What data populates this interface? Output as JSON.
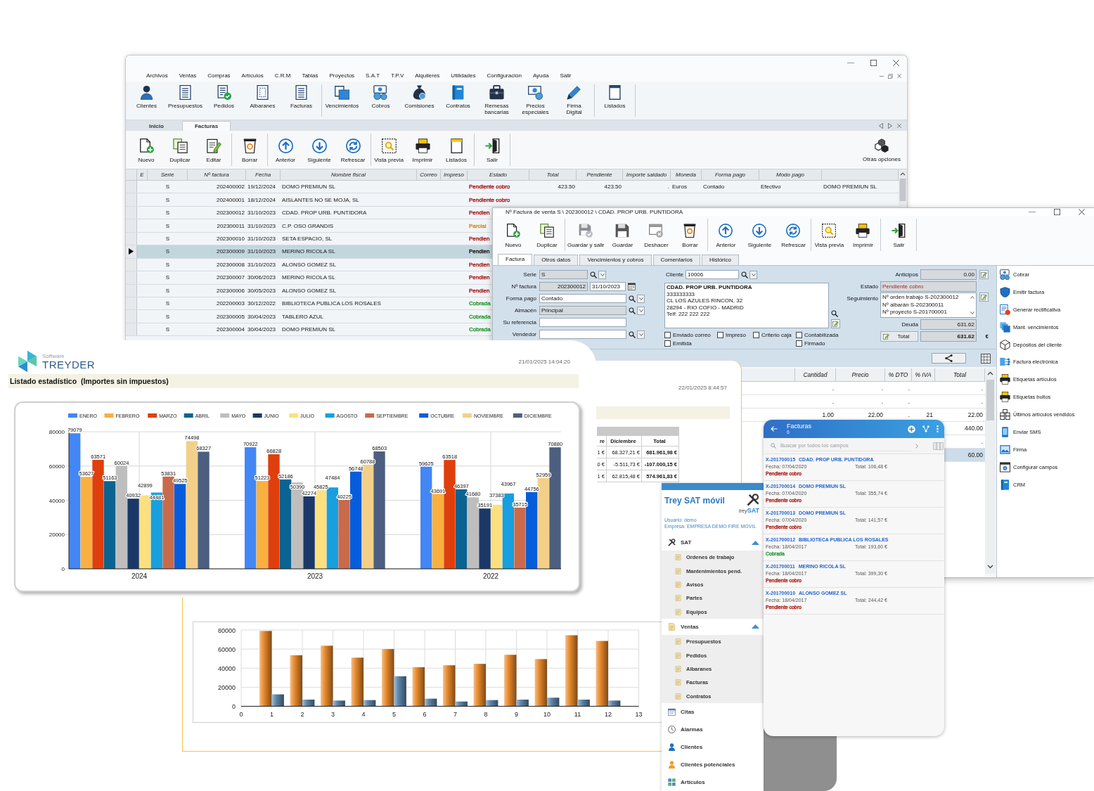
{
  "main_window": {
    "menu": [
      "Archivos",
      "Ventas",
      "Compras",
      "Artículos",
      "C.R.M",
      "Tablas",
      "Proyectos",
      "S.A.T",
      "T.P.V",
      "Alquileres",
      "Utilidades",
      "Configuración",
      "Ayuda",
      "Salir"
    ],
    "ribbon": [
      [
        "Clientes",
        "Presupuestos",
        "Pedidos",
        "Albaranes",
        "Facturas"
      ],
      [
        "Vencimientos",
        "Cobros",
        "Comisiones",
        "Contratos",
        "Remesas bancarias",
        "Precios especiales",
        "Firma Digital"
      ],
      [
        "Listados"
      ]
    ],
    "doc_tabs": [
      {
        "label": "Inicio",
        "selected": false
      },
      {
        "label": "Facturas",
        "selected": true
      }
    ],
    "toolbar": [
      [
        "Nuevo",
        "Duplicar",
        "Editar"
      ],
      [
        "Borrar"
      ],
      [
        "Anterior",
        "Siguiente",
        "Refrescar"
      ],
      [
        "Vista previa",
        "Imprimir",
        "Listados"
      ],
      [
        "Salir"
      ]
    ],
    "more_options": "Otras opciones",
    "table": {
      "columns": [
        "E",
        "Serie",
        "Nº factura",
        "Fecha",
        "Nombre fiscal",
        "Correo",
        "Impreso",
        "Estado",
        "Total",
        "Pendiente",
        "Importe saldado",
        "Moneda",
        "Forma pago",
        "Modo pago"
      ],
      "rows": [
        {
          "selected": false,
          "serie": "S",
          "numero": "202400002",
          "fecha": "19/12/2024",
          "nombre": "DOMO PREMIUN SL",
          "estado": "Pendiente cobro",
          "color": "#a8252b",
          "total": "423.50",
          "pendiente": "423.50",
          "importe_saldado": ".",
          "moneda": "Euros",
          "forma_pago": "Contado",
          "modo_pago": "Efectivo",
          "column_15": "DOMO PREMIUN SL"
        },
        {
          "selected": false,
          "serie": "S",
          "numero": "202400001",
          "fecha": "18/12/2024",
          "nombre": "AISLANTES NO SE MOJA, SL",
          "estado": "Pendiente cobro",
          "color": "#a8252b"
        },
        {
          "selected": false,
          "serie": "S",
          "numero": "202300012",
          "fecha": "31/10/2023",
          "nombre": "CDAD. PROP URB. PUNTIDORA",
          "estado": "Pendien",
          "color": "#a8252b"
        },
        {
          "selected": false,
          "serie": "S",
          "numero": "202300011",
          "fecha": "31/10/2023",
          "nombre": "C.P. OSO GRANDIS",
          "estado": "Parcial",
          "color": "#d98a2e"
        },
        {
          "selected": false,
          "serie": "S",
          "numero": "202300010",
          "fecha": "31/10/2023",
          "nombre": "SETA ESPACIO, SL",
          "estado": "Pendien",
          "color": "#a8252b"
        },
        {
          "selected": true,
          "serie": "S",
          "numero": "202300009",
          "fecha": "31/10/2023",
          "nombre": "MERINO RICOLA SL",
          "estado": "Pendien",
          "color": "#222222"
        },
        {
          "selected": false,
          "serie": "S",
          "numero": "202300008",
          "fecha": "31/10/2023",
          "nombre": "ALONSO GOMEZ SL",
          "estado": "Pendien",
          "color": "#a8252b"
        },
        {
          "selected": false,
          "serie": "S",
          "numero": "202300007",
          "fecha": "30/06/2023",
          "nombre": "MERINO RICOLA SL",
          "estado": "Pendien",
          "color": "#a8252b"
        },
        {
          "selected": false,
          "serie": "S",
          "numero": "202300006",
          "fecha": "30/05/2023",
          "nombre": "ALONSO GOMEZ SL",
          "estado": "Pendien",
          "color": "#a8252b"
        },
        {
          "selected": false,
          "serie": "S",
          "numero": "202200003",
          "fecha": "30/12/2022",
          "nombre": "BIBLIOTECA PUBLICA LOS ROSALES",
          "estado": "Cobrada",
          "color": "#2f9a3a"
        },
        {
          "selected": false,
          "serie": "S",
          "numero": "202300005",
          "fecha": "30/04/2023",
          "nombre": "TABLERO AZUL",
          "estado": "Cobrada",
          "color": "#2f9a3a"
        },
        {
          "selected": false,
          "serie": "S",
          "numero": "202300004",
          "fecha": "30/04/2023",
          "nombre": "DOMO PREMIUN SL",
          "estado": "Cobrada",
          "color": "#2f9a3a"
        }
      ]
    }
  },
  "invoice_window": {
    "title": "Nº Factura de venta S \\ 202300012 \\ CDAD. PROP URB. PUNTIDORA",
    "toolbar": [
      [
        "Nuevo",
        "Duplicar"
      ],
      [
        "Guardar y salir",
        "Guardar",
        "Deshacer",
        "Borrar"
      ],
      [
        "Anterior",
        "Siguiente",
        "Refrescar"
      ],
      [
        "Vista previa",
        "Imprimir"
      ],
      [
        "Salir"
      ]
    ],
    "tabs": [
      {
        "label": "Factura",
        "selected": true
      },
      {
        "label": "Otros datos",
        "selected": false
      },
      {
        "label": "Vencimientos y cobros",
        "selected": false
      },
      {
        "label": "Comentarios",
        "selected": false
      },
      {
        "label": "Histórico",
        "selected": false
      }
    ],
    "form": {
      "fields": [
        {
          "kind": "lookup",
          "label": "Serie",
          "value": "S",
          "readonly": true
        },
        {
          "kind": "number_date",
          "label": "Nº factura",
          "value": "202300012",
          "date": "31/10/2023",
          "readonly": true
        },
        {
          "kind": "lookup",
          "label": "Forma pago",
          "value": "Contado",
          "readonly": false
        },
        {
          "kind": "lookup",
          "label": "Almacén",
          "value": "Principal",
          "readonly": true
        },
        {
          "kind": "text",
          "label": "Su referencia",
          "readonly": false
        },
        {
          "kind": "lookup",
          "label": "Vendedor",
          "readonly": false
        }
      ],
      "client": {
        "label": "Cliente",
        "value": "10006",
        "address": [
          "CDAD. PROP URB. PUNTIDORA",
          "333333333",
          "CL LOS AZULES RINCON, 32",
          "28294 - RIO COFIO - MADRID",
          "Telf: 222 222 222"
        ]
      },
      "checkboxes": [
        {
          "label": "Enviado correo",
          "checked": false
        },
        {
          "label": "Impreso",
          "checked": false
        },
        {
          "label": "Criterio caja",
          "checked": false
        },
        {
          "label": "Contabilizada",
          "checked": false
        },
        {
          "label": "Emitida",
          "checked": false
        },
        {
          "label": "Firmado",
          "checked": false
        }
      ],
      "advances": {
        "label": "Anticipos",
        "value": "0.00"
      },
      "status": {
        "label": "Estado",
        "value": "Pendiente cobro"
      },
      "tracking": {
        "label": "Seguimiento",
        "items": [
          "Nº orden trabajo S-202300012",
          "Nº albarán S-202300011",
          "Nº proyecto S-201700001"
        ]
      },
      "debt": {
        "label": "Deuda",
        "value": "631.62"
      },
      "total": {
        "button": "Total",
        "value": "631.62",
        "currency": "€"
      }
    },
    "side_actions": [
      "Cobrar",
      "Emitir factura",
      "Generar rectificativa",
      "Mant. vencimientos",
      "Depósitos del cliente",
      "Factura electrónica",
      "Etiquetas artículos",
      "Etiquetas bultos",
      "Últimos artículos vendidos",
      "Enviar SMS",
      "Firma",
      "Configurar campos",
      "CRM"
    ],
    "lines": {
      "columns": [
        "Cantidad",
        "Precio",
        "% DTO",
        "% IVA",
        "Total"
      ],
      "rows": [
        {
          "selected": false,
          "cantidad": ".",
          "precio": ".",
          "dto": ".",
          "total": "."
        },
        {
          "selected": false,
          "cantidad": ".",
          "precio": ".",
          "dto": ".",
          "total": "."
        },
        {
          "selected": false,
          "cantidad": "1.00",
          "precio": "22.00",
          "dto": ".",
          "iva": "21",
          "total": "22.00"
        },
        {
          "selected": false,
          "total": "440.00"
        },
        {
          "selected": false,
          "total": "."
        },
        {
          "selected": true,
          "total": "60.00"
        }
      ]
    }
  },
  "report_1": {
    "brand_small": "Software",
    "brand": "TREYDER",
    "date": "21/01/2025 14:04:20",
    "title": "Listado estadístico  (Importes sin impuestos)",
    "chart_data": {
      "type": "bar",
      "categories": [
        "2024",
        "2023",
        "2022"
      ],
      "series": [
        {
          "name": "ENERO",
          "color": "#4287f5",
          "values": [
            79079,
            70922,
            59625
          ]
        },
        {
          "name": "FEBRERO",
          "color": "#f9b040",
          "values": [
            53627,
            51223,
            43691
          ]
        },
        {
          "name": "MARZO",
          "color": "#df3f0d",
          "values": [
            63571,
            66828,
            63518
          ]
        },
        {
          "name": "ABRIL",
          "color": "#0b6391",
          "values": [
            51163,
            52186,
            46397
          ]
        },
        {
          "name": "MAYO",
          "color": "#bebebe",
          "values": [
            60024,
            50390,
            41680
          ]
        },
        {
          "name": "JUNIO",
          "color": "#1b3868",
          "values": [
            40932,
            42274,
            35191
          ]
        },
        {
          "name": "JULIO",
          "color": "#fde07e",
          "values": [
            42899,
            45825,
            37383
          ]
        },
        {
          "name": "AGOSTO",
          "color": "#179fdf",
          "values": [
            44481,
            47484,
            43967
          ]
        },
        {
          "name": "SEPTIEMBRE",
          "color": "#c96a4b",
          "values": [
            53831,
            40225,
            35715
          ]
        },
        {
          "name": "OCTUBRE",
          "color": "#065ddc",
          "values": [
            49525,
            56748,
            44756
          ]
        },
        {
          "name": "NOVIEMBRE",
          "color": "#f3d089",
          "values": [
            74498,
            60788,
            52959
          ]
        },
        {
          "name": "DICIEMBRE",
          "color": "#4d5f80",
          "values": [
            68327,
            68503,
            70880
          ]
        }
      ],
      "ylim": [
        0,
        80000
      ],
      "yticks": [
        0,
        20000,
        40000,
        60000,
        80000
      ],
      "grid": true,
      "legend": "top",
      "data_labels": true
    }
  },
  "report_2": {
    "date": "22/01/2025 8:44:57",
    "table": {
      "columns": [
        "re",
        "Diciembre",
        "Total"
      ],
      "rows": [
        [
          "1 €",
          "68.327,21 €",
          "681.961,98 €"
        ],
        [
          "0 €",
          "-5.511,73 €",
          "-107.000,15 €"
        ],
        [
          "1 €",
          "62.815,48 €",
          "574.961,83 €"
        ]
      ]
    },
    "chart_data": {
      "type": "bar",
      "x": [
        1,
        2,
        3,
        4,
        5,
        6,
        7,
        8,
        9,
        10,
        11,
        12
      ],
      "series": [
        {
          "color": "#e8892b",
          "values": [
            79000,
            53500,
            63500,
            51000,
            60000,
            41000,
            43000,
            44500,
            54000,
            49500,
            74500,
            68500
          ]
        },
        {
          "color": "#5d86ab",
          "values": [
            12500,
            7000,
            6000,
            6500,
            31500,
            8000,
            5000,
            6500,
            7000,
            9000,
            7000,
            6000
          ]
        }
      ],
      "xlim": [
        0,
        13
      ],
      "xticks": [
        0,
        1,
        2,
        3,
        4,
        5,
        6,
        7,
        8,
        9,
        10,
        11,
        12,
        13
      ],
      "ylim": [
        0,
        80000
      ],
      "yticks": [
        0,
        20000,
        40000,
        60000,
        80000
      ],
      "grid": true
    }
  },
  "mobile_menu": {
    "title": "Trey SAT móvil",
    "logo_text": "trey**SAT**",
    "user": "Usuario: demo",
    "company": "Empresa: EMPRESA DEMO FIRE MOVIL",
    "items": [
      {
        "label": "SAT",
        "expanded": true,
        "children": [
          {
            "label": "Ordenes de trabajo"
          },
          {
            "label": "Mantenimientos pend."
          },
          {
            "label": "Avisos"
          },
          {
            "label": "Partes"
          },
          {
            "label": "Equipos"
          }
        ]
      },
      {
        "label": "Ventas",
        "expanded": true,
        "children": [
          {
            "label": "Presupuestos"
          },
          {
            "label": "Pedidos"
          },
          {
            "label": "Albaranes"
          },
          {
            "label": "Facturas"
          },
          {
            "label": "Contratos"
          }
        ]
      },
      {
        "label": "Citas"
      },
      {
        "label": "Alarmas"
      },
      {
        "label": "Clientes"
      },
      {
        "label": "Clientes potenciales"
      },
      {
        "label": "Artículos"
      }
    ]
  },
  "mobile_list": {
    "title": "Facturas",
    "count": "6",
    "search": {
      "placeholder": "Buscar por todos los campos"
    },
    "items": [
      {
        "number": "X-201700015",
        "name": "CDAD. PROP URB. PUNTIDORA",
        "date": "Fecha: 07/04/2020",
        "total": "Total: 106,48 €",
        "status": "Pendiente cobro",
        "color": "#b3261e"
      },
      {
        "number": "X-201700014",
        "name": "DOMO PREMIUN SL",
        "date": "Fecha: 07/04/2020",
        "total": "Total: 355,74 €",
        "status": "Pendiente cobro",
        "color": "#b3261e"
      },
      {
        "number": "X-201700013",
        "name": "DOMO PREMIUN SL",
        "date": "Fecha: 07/04/2020",
        "total": "Total: 141,57 €",
        "status": "Pendiente cobro",
        "color": "#b3261e"
      },
      {
        "number": "X-201700012",
        "name": "BIBLIOTECA PUBLICA LOS ROSALES",
        "date": "Fecha: 18/04/2017",
        "total": "Total: 193,60 €",
        "status": "Cobrada",
        "color": "#2e9e3e"
      },
      {
        "number": "X-201700011",
        "name": "MERINO RICOLA SL",
        "date": "Fecha: 18/04/2017",
        "total": "Total: 399,30 €",
        "status": "Pendiente cobro",
        "color": "#b3261e"
      },
      {
        "number": "X-201700010",
        "name": "ALONSO GOMEZ SL",
        "date": "Fecha: 18/04/2017",
        "total": "Total: 244,42 €",
        "status": "Pendiente cobro",
        "color": "#b3261e"
      }
    ]
  }
}
